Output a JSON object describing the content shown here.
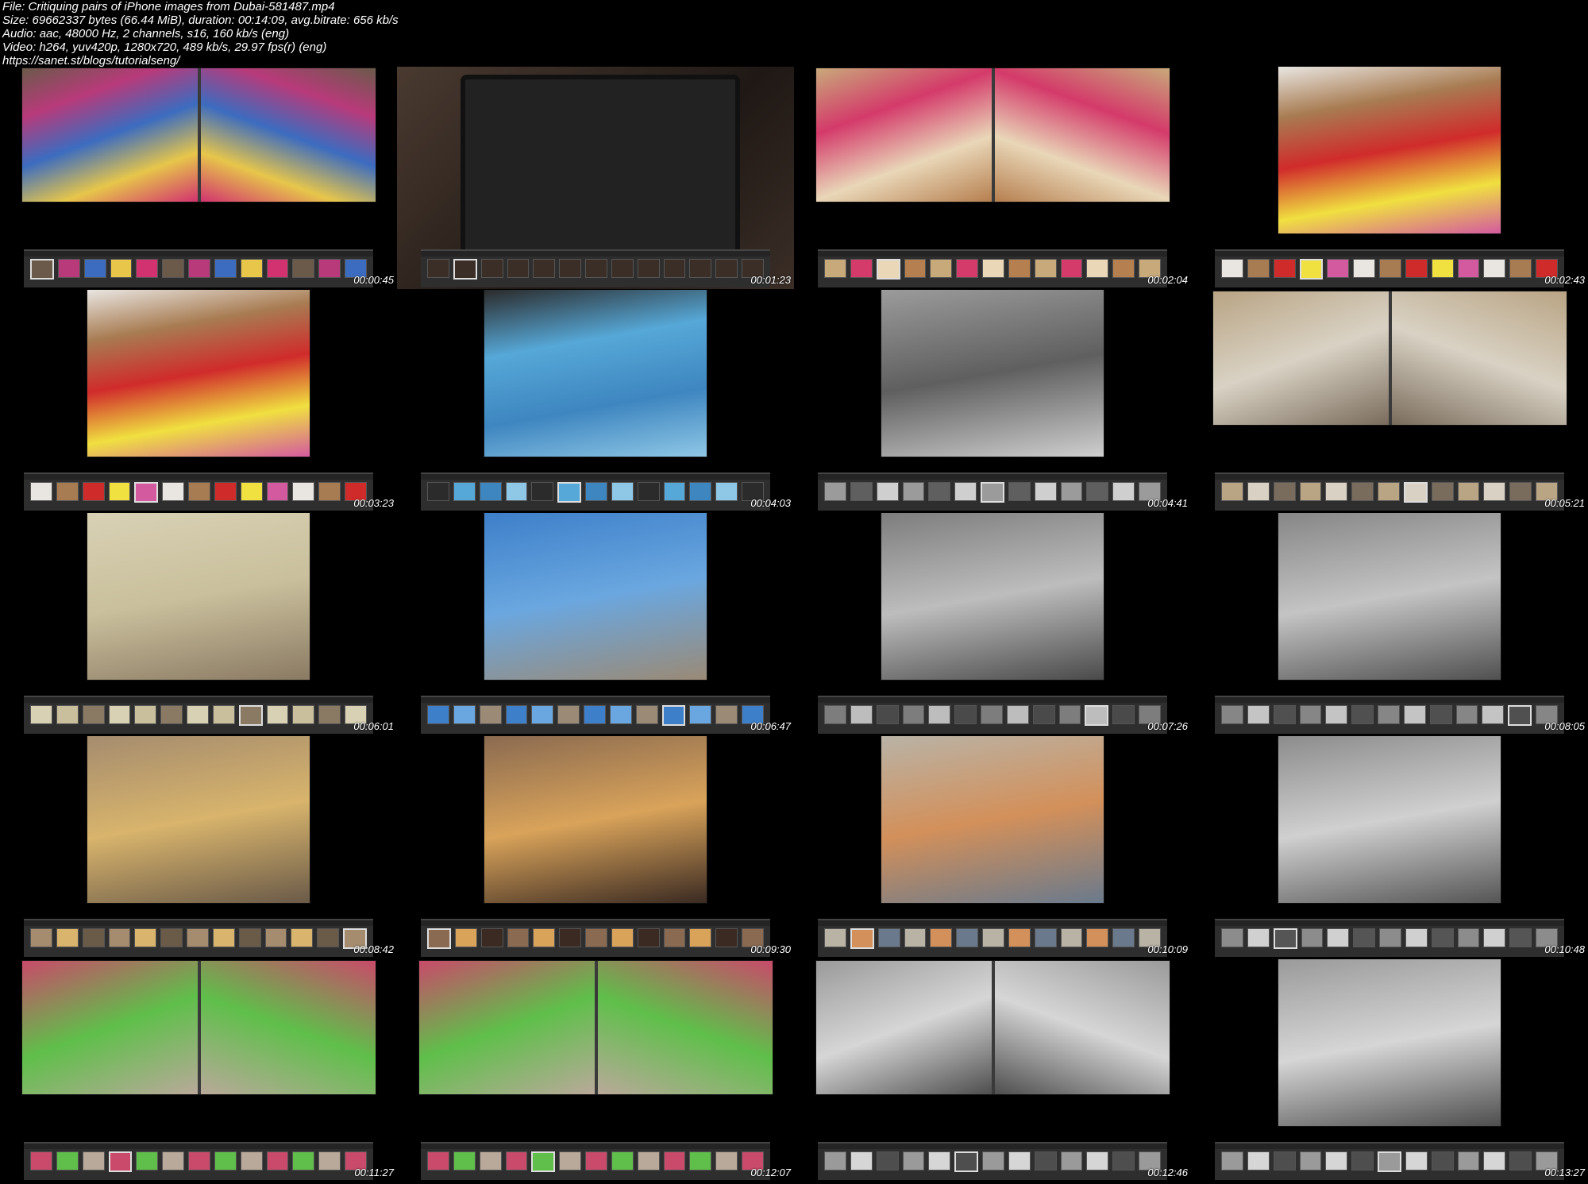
{
  "header": {
    "line1": "File: Critiquing pairs of iPhone images from Dubai-581487.mp4",
    "line2": "Size: 69662337 bytes (66.44 MiB), duration: 00:14:09, avg.bitrate: 656 kb/s",
    "line3": "Audio: aac, 48000 Hz, 2 channels, s16, 160 kb/s (eng)",
    "line4": "Video: h264, yuv420p, 1280x720, 489 kb/s, 29.97 fps(r) (eng)",
    "line5": "https://sanet.st/blogs/tutorialseng/"
  },
  "frames": [
    {
      "time": "00:00:45",
      "subject": "dresses-pair"
    },
    {
      "time": "00:01:23",
      "subject": "laptop-view"
    },
    {
      "time": "00:02:04",
      "subject": "mannequin-boxes-pair"
    },
    {
      "time": "00:02:43",
      "subject": "mannequin-heads"
    },
    {
      "time": "00:03:23",
      "subject": "mannequin-heads"
    },
    {
      "time": "00:04:03",
      "subject": "globes"
    },
    {
      "time": "00:04:41",
      "subject": "street-bw"
    },
    {
      "time": "00:05:21",
      "subject": "cart-pair"
    },
    {
      "time": "00:06:01",
      "subject": "courtyard"
    },
    {
      "time": "00:06:47",
      "subject": "water-bottles"
    },
    {
      "time": "00:07:26",
      "subject": "alley-bw"
    },
    {
      "time": "00:08:05",
      "subject": "wall-bw"
    },
    {
      "time": "00:08:42",
      "subject": "hand-truck"
    },
    {
      "time": "00:09:30",
      "subject": "bench-mannequin"
    },
    {
      "time": "00:10:09",
      "subject": "porters"
    },
    {
      "time": "00:10:48",
      "subject": "street-boxes-bw"
    },
    {
      "time": "00:11:27",
      "subject": "fabric-pair"
    },
    {
      "time": "00:12:07",
      "subject": "fabric-pair"
    },
    {
      "time": "00:12:46",
      "subject": "gate-pair-bw"
    },
    {
      "time": "00:13:27",
      "subject": "gate-bw"
    }
  ],
  "colors": {
    "background": "#000000",
    "filmstrip": "#2e2e2e",
    "text": "#ffffff"
  }
}
